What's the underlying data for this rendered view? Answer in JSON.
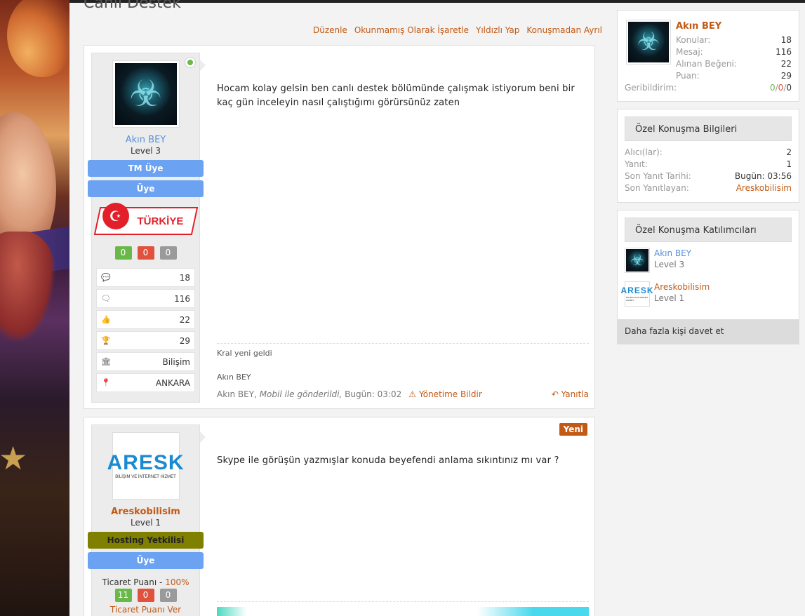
{
  "page": {
    "title": "Canlı Destek"
  },
  "actions": [
    "Düzenle",
    "Okunmamış Olarak İşaretle",
    "Yıldızlı Yap",
    "Konuşmadan Ayrıl"
  ],
  "posts": [
    {
      "user": {
        "name": "Akın BEY",
        "level": "Level 3",
        "ribbons": [
          "TM Üye",
          "Üye"
        ],
        "badge_text": "TÜRKİYE",
        "rep": [
          "0",
          "0",
          "0"
        ],
        "stats": [
          {
            "icon": "comment-icon",
            "glyph": "💬",
            "value": "18"
          },
          {
            "icon": "comments-icon",
            "glyph": "🗨",
            "value": "116"
          },
          {
            "icon": "thumbs-up-icon",
            "glyph": "👍",
            "value": "22"
          },
          {
            "icon": "trophy-icon",
            "glyph": "🏆",
            "value": "29"
          },
          {
            "icon": "bank-icon",
            "glyph": "🏛",
            "value": "Bilişim"
          },
          {
            "icon": "map-pin-icon",
            "glyph": "📍",
            "value": "ANKARA"
          }
        ]
      },
      "message": "Hocam kolay gelsin ben canlı destek bölümünde çalışmak istiyorum beni bir kaç gün inceleyin nasıl çalıştığımı görürsünüz zaten",
      "signature": "Kral yeni geldi",
      "signature_author": "Akın BEY",
      "meta": {
        "author": "Akın BEY,",
        "device": "Mobil ile gönderildi,",
        "time": "Bugün: 03:02",
        "report": "Yönetime Bildir",
        "reply": "Yanıtla"
      }
    },
    {
      "badge": "Yeni",
      "user": {
        "name": "Areskobilisim",
        "level": "Level 1",
        "ribbons": [
          "Hosting Yetkilisi",
          "Üye"
        ],
        "logo_big": "ARESK",
        "logo_small": "BİLİŞİM VE İNTERNET HİZMET",
        "trade_label": "Ticaret Puanı - ",
        "trade_pct": "100%",
        "rep": [
          "11",
          "0",
          "0"
        ],
        "trade_give": "Ticaret Puanı Ver"
      },
      "message": "Skype ile görüşün yazmışlar konuda beyefendi anlama sıkıntınız mı var ?"
    }
  ],
  "sidebar": {
    "profile": {
      "name": "Akın BEY",
      "rows": [
        {
          "k": "Konular:",
          "v": "18"
        },
        {
          "k": "Mesaj:",
          "v": "116"
        },
        {
          "k": "Alınan Beğeni:",
          "v": "22"
        },
        {
          "k": "Puan:",
          "v": "29"
        }
      ],
      "feedback_label": "Geribildirim:",
      "fb_pos": "0",
      "fb_neu": "0",
      "fb_neg": "0",
      "fb_sep": "/"
    },
    "info": {
      "title": "Özel Konuşma Bilgileri",
      "rows": [
        {
          "k": "Alıcı(lar):",
          "v": "2"
        },
        {
          "k": "Yanıt:",
          "v": "1"
        },
        {
          "k": "Son Yanıt Tarihi:",
          "v": "Bugün: 03:56"
        },
        {
          "k": "Son Yanıtlayan:",
          "v": "Areskobilisim"
        }
      ]
    },
    "participants": {
      "title": "Özel Konuşma Katılımcıları",
      "list": [
        {
          "name": "Akın BEY",
          "level": "Level 3"
        },
        {
          "name": "Areskobilisim",
          "level": "Level 1"
        }
      ],
      "invite": "Daha fazla kişi davet et"
    }
  },
  "colors": {
    "accent": "#c25a15",
    "blue_name": "#5b8fd8",
    "ribbon_blue": "#6ba2f2",
    "ribbon_olive": "#7f7f00",
    "green": "#6ab84a",
    "red": "#e0513e"
  }
}
